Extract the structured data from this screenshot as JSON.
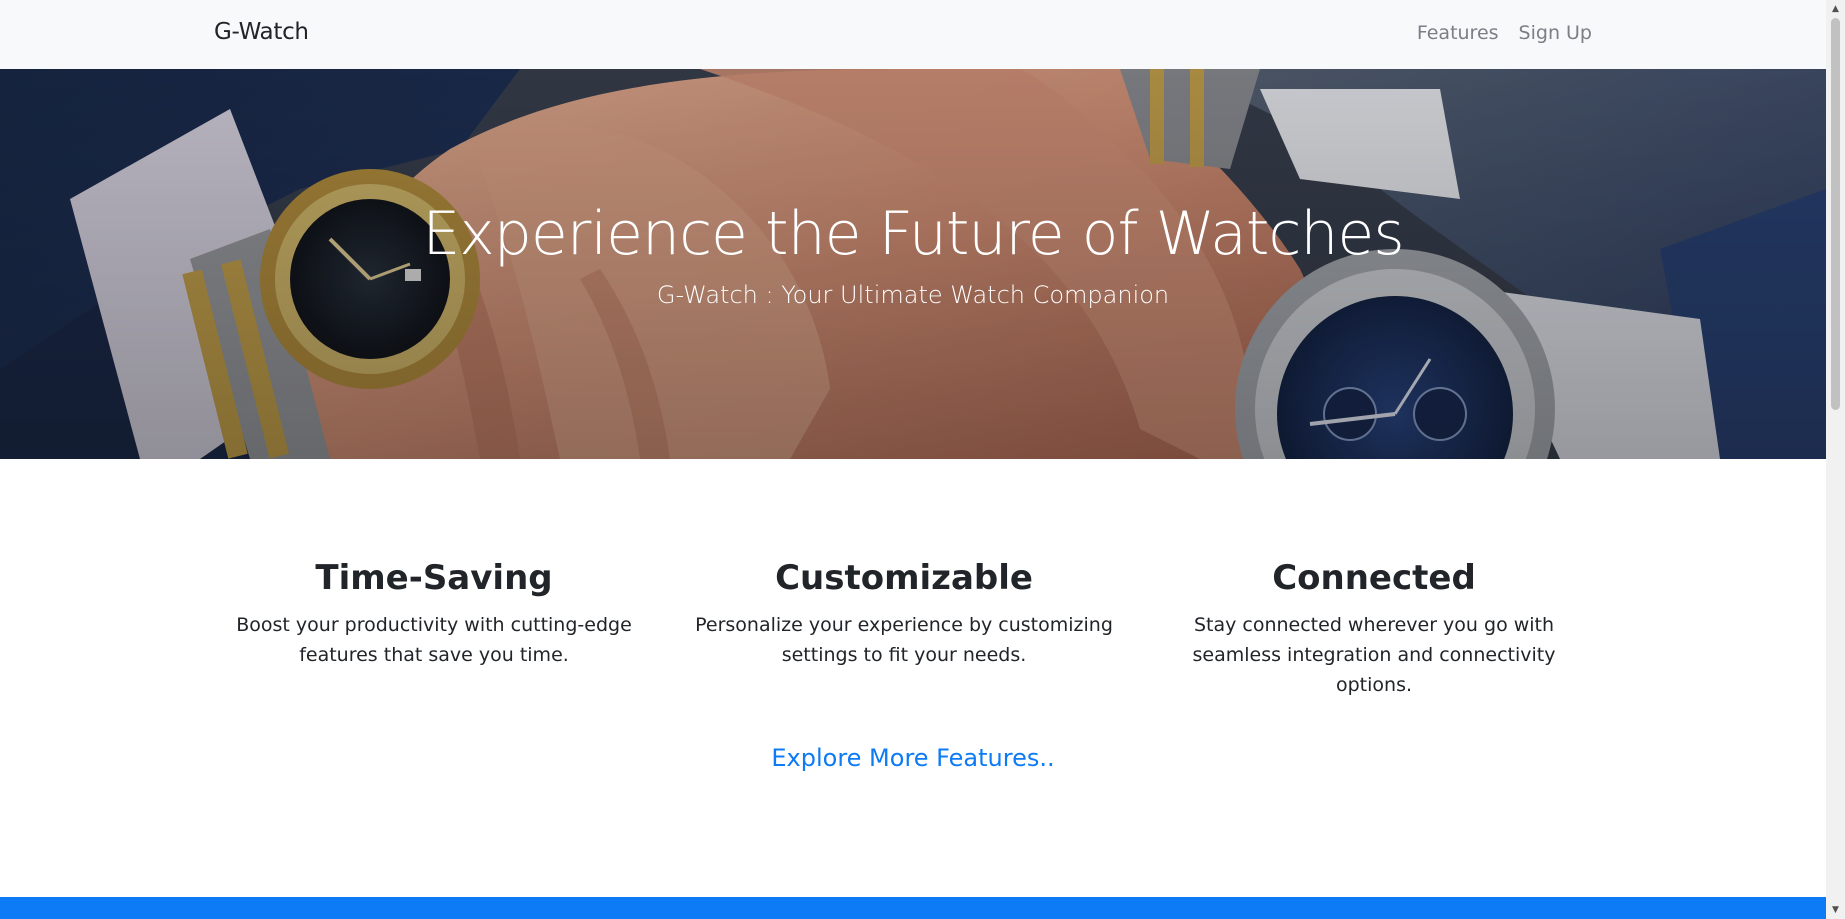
{
  "navbar": {
    "brand": "G-Watch",
    "links": [
      {
        "label": "Features"
      },
      {
        "label": "Sign Up"
      }
    ]
  },
  "hero": {
    "title": "Experience the Future of Watches",
    "subtitle": "G-Watch : Your Ultimate Watch Companion"
  },
  "features": [
    {
      "title": "Time-Saving",
      "description": "Boost your productivity with cutting-edge features that save you time."
    },
    {
      "title": "Customizable",
      "description": "Personalize your experience by customizing settings to fit your needs."
    },
    {
      "title": "Connected",
      "description": "Stay connected wherever you go with seamless integration and connectivity options."
    }
  ],
  "explore_link": "Explore More Features..",
  "colors": {
    "accent": "#0d7bf5",
    "navbar_bg": "#f8f9fa",
    "text": "#212529",
    "nav_link": "#7a7f85"
  },
  "icons": {
    "scroll_up": "chevron-up-icon",
    "scroll_down": "chevron-down-icon"
  }
}
